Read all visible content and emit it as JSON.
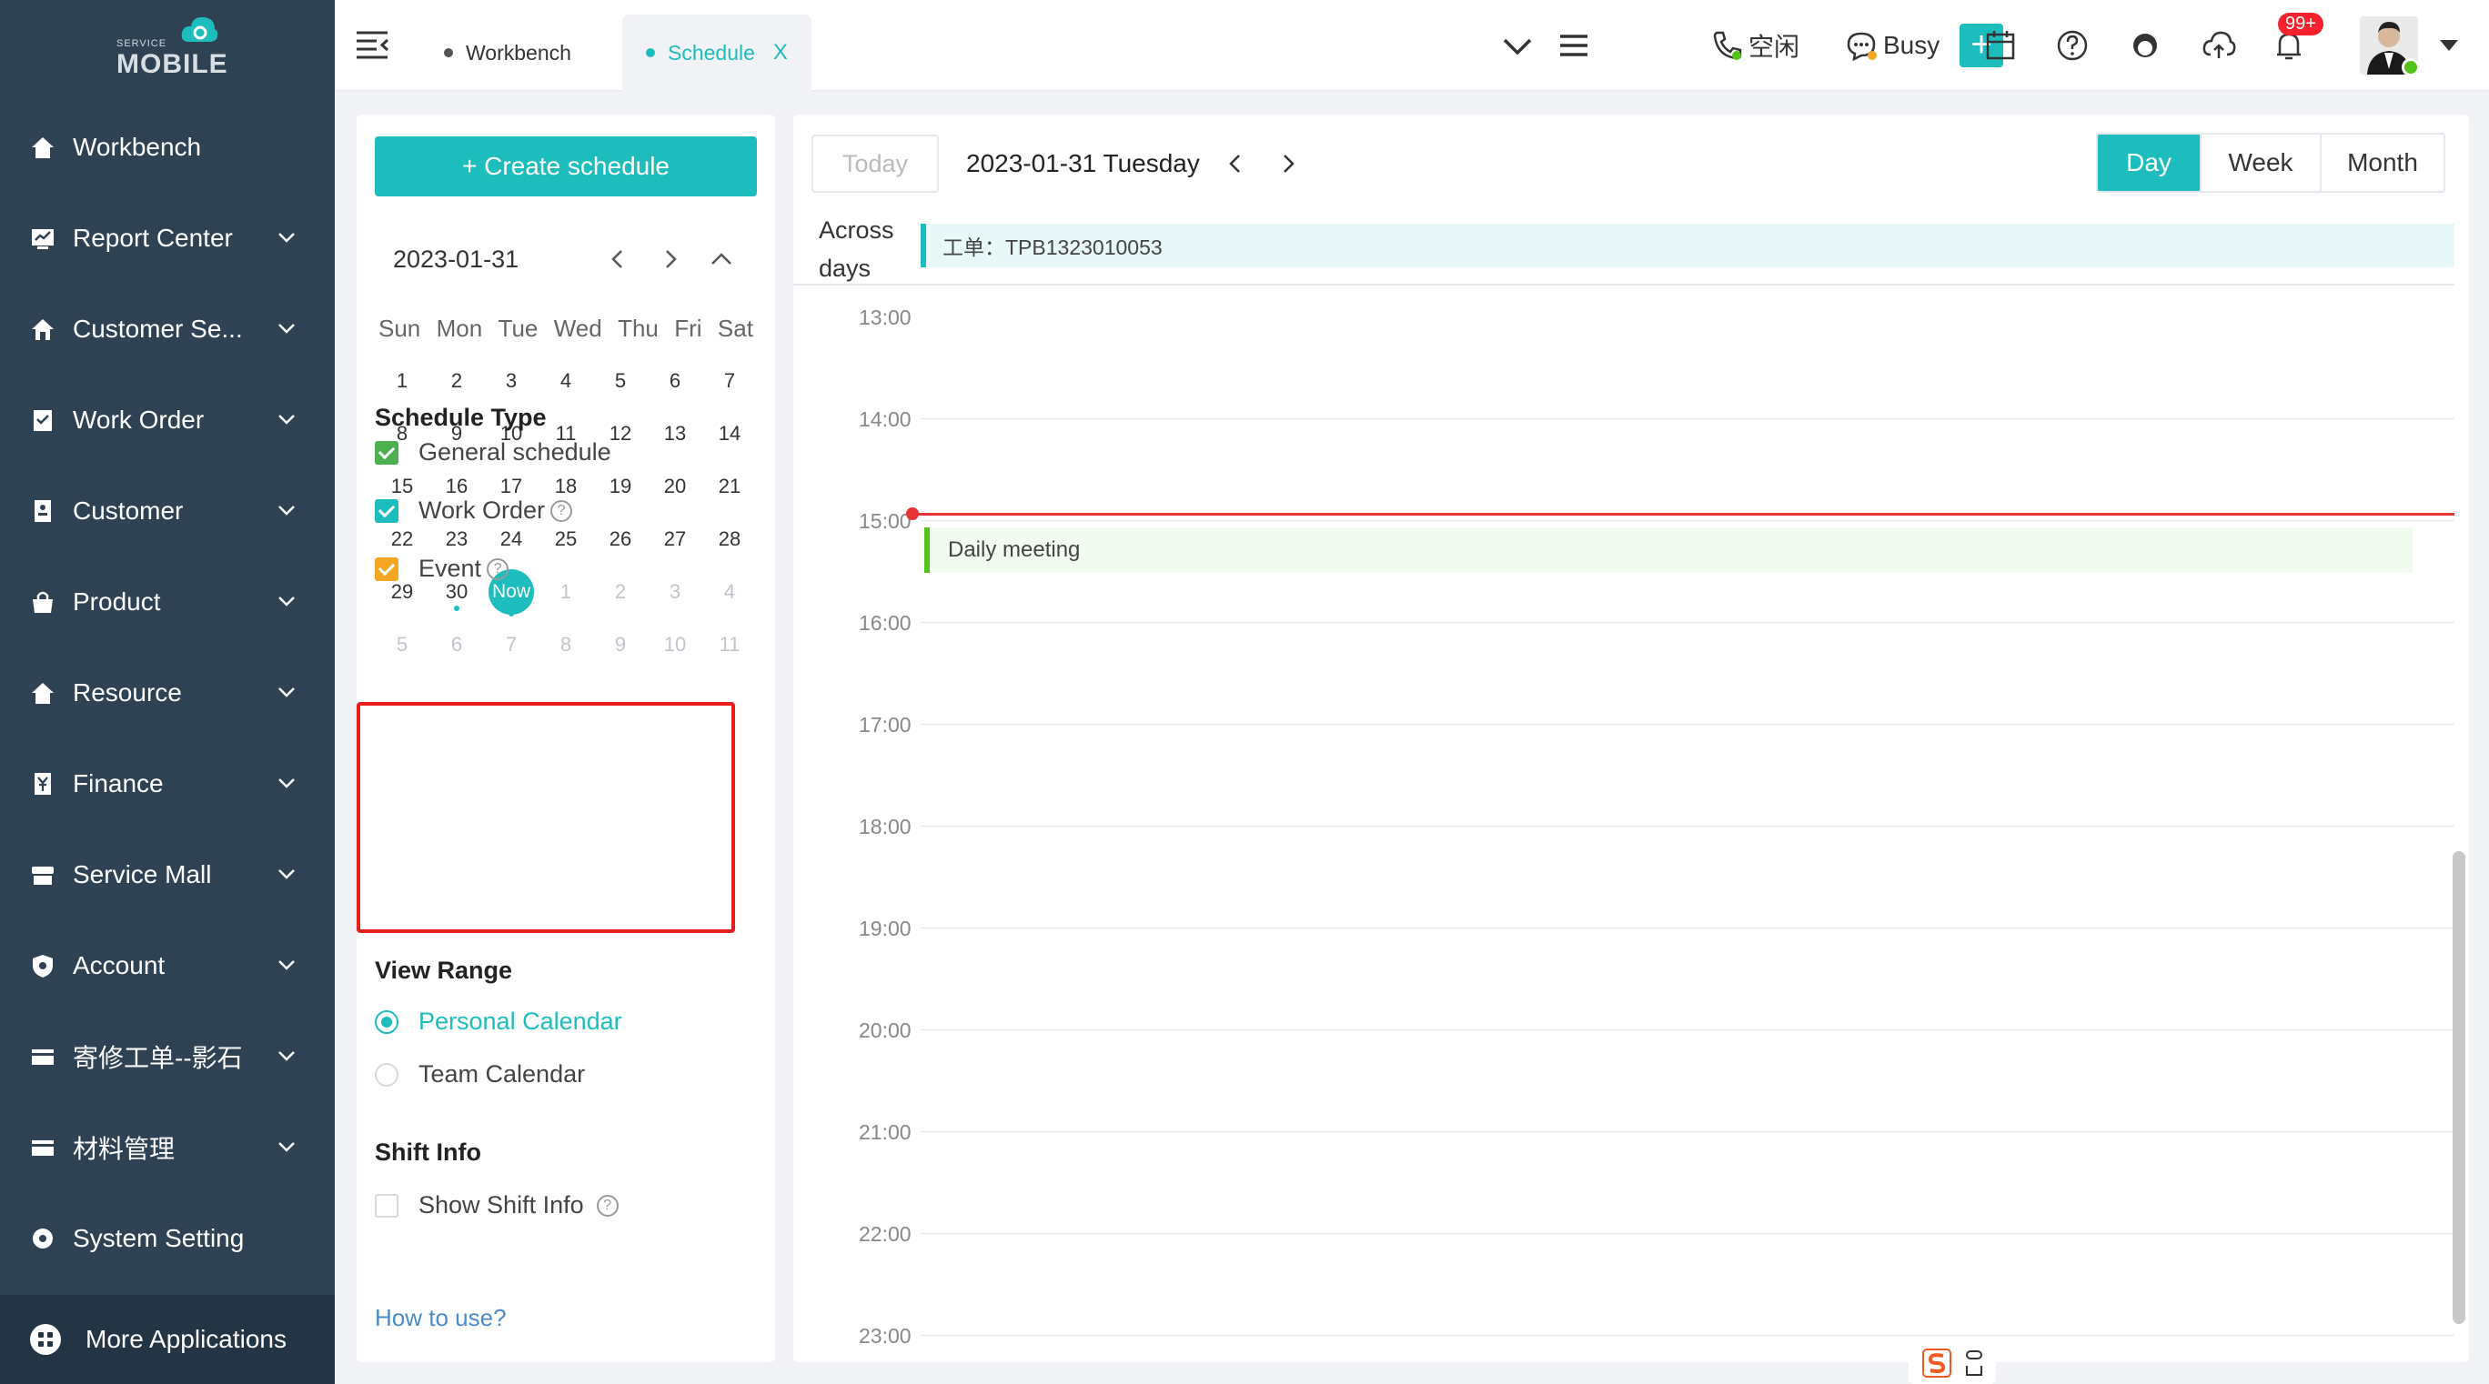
{
  "sidebar": {
    "logo_small": "SERVICE",
    "logo_big": "MOBILE",
    "items": [
      {
        "label": "Workbench",
        "icon": "home-icon"
      },
      {
        "label": "Report Center",
        "icon": "report-icon"
      },
      {
        "label": "Customer Se...",
        "icon": "home-icon"
      },
      {
        "label": "Work Order",
        "icon": "clipboard-icon"
      },
      {
        "label": "Customer",
        "icon": "id-card-icon"
      },
      {
        "label": "Product",
        "icon": "bag-icon"
      },
      {
        "label": "Resource",
        "icon": "home-icon"
      },
      {
        "label": "Finance",
        "icon": "yen-icon"
      },
      {
        "label": "Service Mall",
        "icon": "store-icon"
      },
      {
        "label": "Account",
        "icon": "shield-icon"
      },
      {
        "label": "寄修工单--影石",
        "icon": "card-icon"
      },
      {
        "label": "材料管理",
        "icon": "card-icon"
      },
      {
        "label": "System Setting",
        "icon": "gear-icon"
      }
    ],
    "more_apps": "More Applications"
  },
  "topbar": {
    "tabs": [
      {
        "label": "Workbench"
      },
      {
        "label": "Schedule",
        "close": "X"
      }
    ],
    "status_idle": "空闲",
    "status_busy": "Busy",
    "badge": "99+"
  },
  "left": {
    "create_btn": "+ Create schedule",
    "mini_cal_title": "2023-01-31",
    "weekdays": [
      "Sun",
      "Mon",
      "Tue",
      "Wed",
      "Thu",
      "Fri",
      "Sat"
    ],
    "days": [
      [
        "1",
        "2",
        "3",
        "4",
        "5",
        "6",
        "7"
      ],
      [
        "8",
        "9",
        "10",
        "11",
        "12",
        "13",
        "14"
      ],
      [
        "15",
        "16",
        "17",
        "18",
        "19",
        "20",
        "21"
      ],
      [
        "22",
        "23",
        "24",
        "25",
        "26",
        "27",
        "28"
      ],
      [
        "29",
        "30",
        "Now",
        "1",
        "2",
        "3",
        "4"
      ],
      [
        "5",
        "6",
        "7",
        "8",
        "9",
        "10",
        "11"
      ]
    ],
    "schedule_type_title": "Schedule Type",
    "schedule_types": [
      {
        "label": "General schedule",
        "color": "#4caf50"
      },
      {
        "label": "Work Order",
        "color": "#1ebdbd"
      },
      {
        "label": "Event",
        "color": "#f5a623"
      }
    ],
    "view_range_title": "View Range",
    "view_ranges": [
      {
        "label": "Personal Calendar"
      },
      {
        "label": "Team Calendar"
      }
    ],
    "shift_info_title": "Shift Info",
    "shift_info_label": "Show Shift Info",
    "how_link": "How to use?"
  },
  "calendar": {
    "today_btn": "Today",
    "current_date": "2023-01-31 Tuesday",
    "views": [
      "Day",
      "Week",
      "Month"
    ],
    "across_label_1": "Across",
    "across_label_2": "days",
    "across_event": "工单：TPB1323010053",
    "hours": [
      "13:00",
      "14:00",
      "15:00",
      "16:00",
      "17:00",
      "18:00",
      "19:00",
      "20:00",
      "21:00",
      "22:00",
      "23:00"
    ],
    "event": "Daily meeting"
  }
}
